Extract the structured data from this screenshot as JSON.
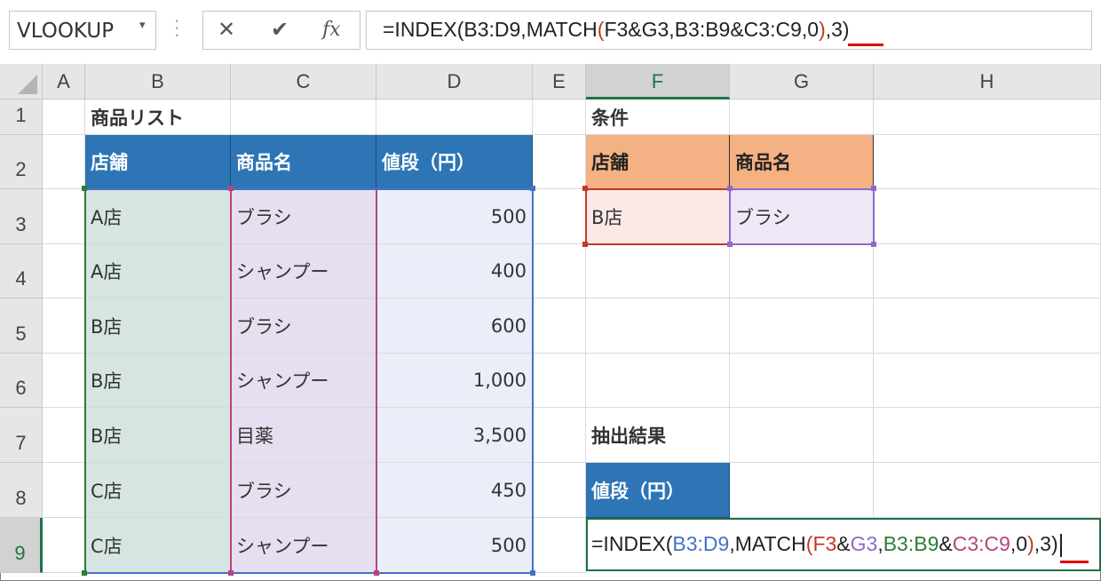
{
  "formula_bar": {
    "name_box": "VLOOKUP",
    "cancel_icon": "✕",
    "enter_icon": "✔",
    "fx_label": "fx",
    "formula_parts": [
      "=INDEX(B3:D9,MATCH",
      "(",
      "F3&G3,B3:B9&C3:C9,0",
      ")",
      ",3)"
    ]
  },
  "columns": [
    "A",
    "B",
    "C",
    "D",
    "E",
    "F",
    "G",
    "H"
  ],
  "rows": [
    "1",
    "2",
    "3",
    "4",
    "5",
    "6",
    "7",
    "8",
    "9"
  ],
  "title": "商品リスト",
  "table_headers": [
    "店舗",
    "商品名",
    "値段（円）"
  ],
  "table_rows": [
    {
      "store": "A店",
      "product": "ブラシ",
      "price": "500"
    },
    {
      "store": "A店",
      "product": "シャンプー",
      "price": "400"
    },
    {
      "store": "B店",
      "product": "ブラシ",
      "price": "600"
    },
    {
      "store": "B店",
      "product": "シャンプー",
      "price": "1,000"
    },
    {
      "store": "B店",
      "product": "目薬",
      "price": "3,500"
    },
    {
      "store": "C店",
      "product": "ブラシ",
      "price": "450"
    },
    {
      "store": "C店",
      "product": "シャンプー",
      "price": "500"
    }
  ],
  "conditions": {
    "title": "条件",
    "headers": [
      "店舗",
      "商品名"
    ],
    "values": [
      "B店",
      "ブラシ"
    ]
  },
  "result": {
    "title": "抽出結果",
    "header": "値段（円）"
  },
  "edit_formula": {
    "parts": [
      "=INDEX(",
      "B3:D9",
      ",MATCH",
      "(",
      "F3",
      "&",
      "G3",
      ",",
      "B3:B9",
      "&",
      "C3:C9",
      ",0",
      ")",
      ",3)"
    ]
  },
  "colors": {
    "header_blue": "#2e75b6",
    "header_orange": "#f4b183",
    "range_blue": "#4472c4",
    "range_green": "#2e7d32",
    "range_pink": "#b5457f",
    "range_red": "#c0392b",
    "range_purple": "#8e6ac8",
    "underline_red": "#e00000",
    "excel_green": "#217346"
  }
}
